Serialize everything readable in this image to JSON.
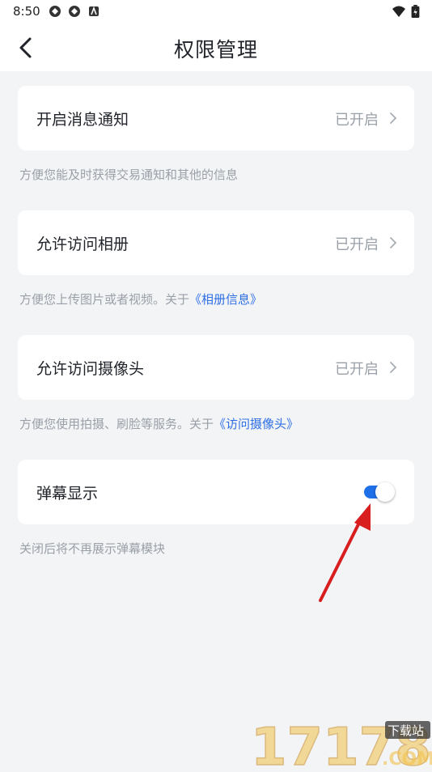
{
  "status_bar": {
    "time": "8:50"
  },
  "header": {
    "title": "权限管理"
  },
  "items": [
    {
      "label": "开启消息通知",
      "status": "已开启",
      "hint": "方便您能及时获得交易通知和其他的信息"
    },
    {
      "label": "允许访问相册",
      "status": "已开启",
      "hint": "方便您上传图片或者视频。关于",
      "hint_link": "《相册信息》"
    },
    {
      "label": "允许访问摄像头",
      "status": "已开启",
      "hint": "方便您使用拍摄、刷脸等服务。关于",
      "hint_link": "《访问摄像头》"
    }
  ],
  "danmaku": {
    "label": "弹幕显示",
    "enabled": true,
    "hint": "关闭后将不再展示弹幕模块"
  },
  "watermark": {
    "text": "17178",
    "badge": "下载站",
    "suffix": ".COM"
  },
  "colors": {
    "accent": "#1f6fe8",
    "link": "#2f6fe4",
    "background": "#f3f4f6",
    "annotation_arrow": "#d81e1e"
  }
}
